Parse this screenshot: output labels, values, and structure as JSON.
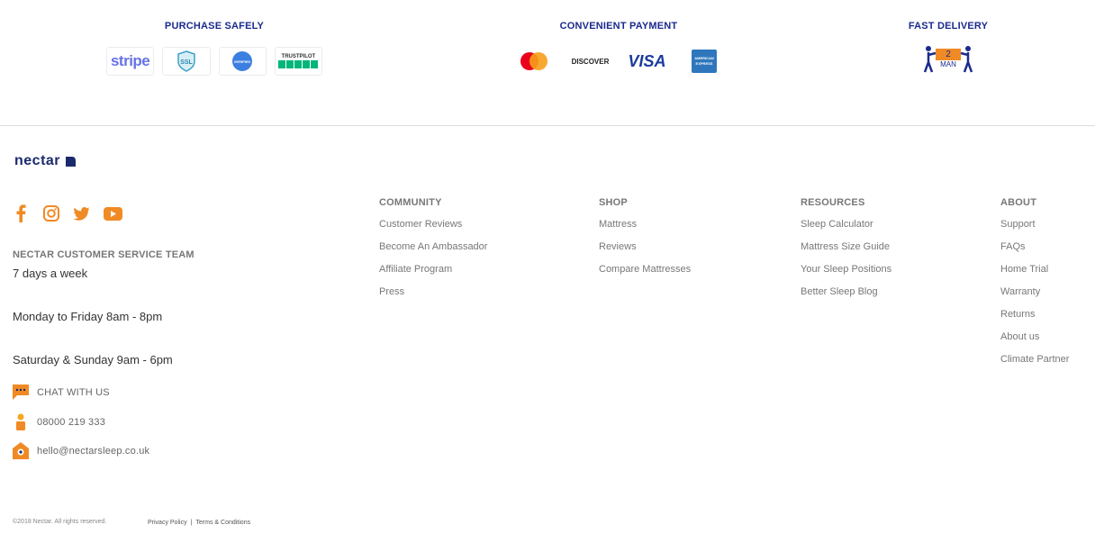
{
  "trust": {
    "safe": {
      "title": "PURCHASE SAFELY",
      "badges": [
        "stripe",
        "SSL",
        "VERIFIED",
        "TRUSTPILOT"
      ]
    },
    "pay": {
      "title": "CONVENIENT PAYMENT",
      "badges": [
        "mastercard",
        "DISCOVER",
        "VISA",
        "AMERICAN EXPRESS"
      ]
    },
    "delivery": {
      "title": "FAST DELIVERY",
      "badge_text_top": "2",
      "badge_text_bottom": "MAN"
    }
  },
  "brand": {
    "name": "nectar"
  },
  "social": [
    "facebook-icon",
    "instagram-icon",
    "twitter-icon",
    "youtube-icon"
  ],
  "customer_service": {
    "title": "NECTAR CUSTOMER SERVICE TEAM",
    "lines": [
      "7 days a week",
      "Monday to Friday 8am - 8pm",
      "Saturday & Sunday 9am - 6pm"
    ]
  },
  "contact": {
    "chat": "CHAT WITH US",
    "phone": "08000 219 333",
    "email": "hello@nectarsleep.co.uk"
  },
  "columns": [
    {
      "title": "COMMUNITY",
      "items": [
        "Customer Reviews",
        "Become An Ambassador",
        "Affiliate Program",
        "Press"
      ]
    },
    {
      "title": "SHOP",
      "items": [
        "Mattress",
        "Reviews",
        "Compare Mattresses"
      ]
    },
    {
      "title": "RESOURCES",
      "items": [
        "Sleep Calculator",
        "Mattress Size Guide",
        "Your Sleep Positions",
        "Better Sleep Blog"
      ]
    },
    {
      "title": "ABOUT",
      "items": [
        "Support",
        "FAQs",
        "Home Trial",
        "Warranty",
        "Returns",
        "About us",
        "Climate Partner"
      ]
    }
  ],
  "legal": {
    "copyright": "©2018 Nectar. All rights reserved.",
    "privacy": "Privacy Policy",
    "separator": "|",
    "terms": "Terms & Conditions"
  },
  "colors": {
    "navy": "#1a2a8c",
    "orange": "#f08a24",
    "divider": "#dcdcdc"
  }
}
